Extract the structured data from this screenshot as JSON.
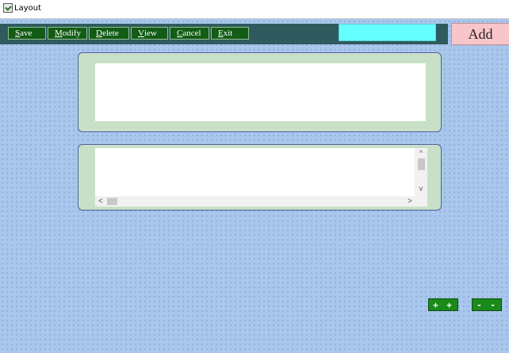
{
  "window": {
    "title": "Layout",
    "icon": "form-icon"
  },
  "toolbar": {
    "buttons": [
      {
        "label": "Save",
        "accel": "S",
        "rest": "ave"
      },
      {
        "label": "Modify",
        "accel": "M",
        "rest": "odify"
      },
      {
        "label": "Delete",
        "accel": "D",
        "rest": "elete"
      },
      {
        "label": "View",
        "accel": "V",
        "rest": "iew"
      },
      {
        "label": "Cancel",
        "accel": "C",
        "rest": "ancel"
      },
      {
        "label": "Exit",
        "accel": "E",
        "rest": "xit"
      }
    ]
  },
  "cyan_field": {
    "value": ""
  },
  "add_button": {
    "label": "Add"
  },
  "bottom_buttons": {
    "plus_label": "+ +",
    "minus_label": "- -"
  },
  "scrollbars": {
    "up": "^",
    "down": "v",
    "left": "<",
    "right": ">"
  },
  "colors": {
    "canvas": "#a9c6ec",
    "toolbar": "#2f5b5e",
    "toolbar_button": "#135c16",
    "panel": "#c7e0c7",
    "cyan_field": "#66ffff",
    "add_button": "#f8c6ca",
    "small_button": "#1a8a1a"
  }
}
